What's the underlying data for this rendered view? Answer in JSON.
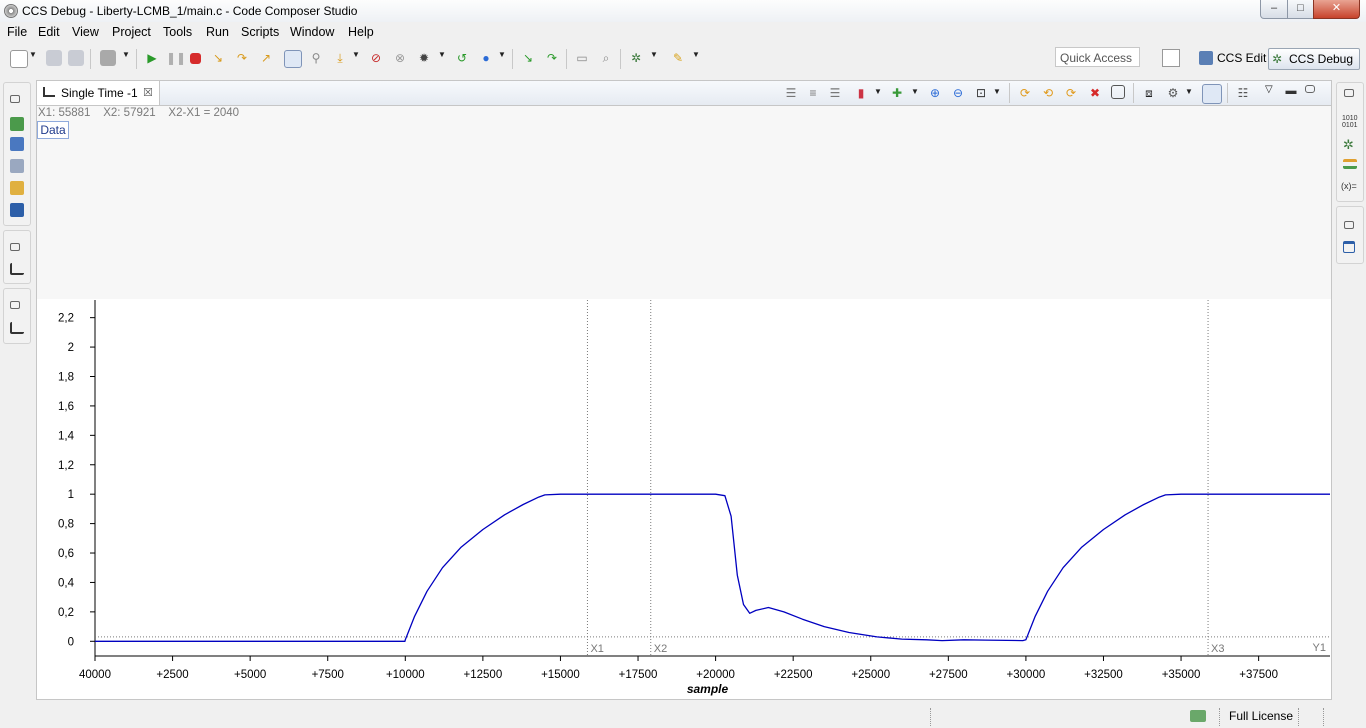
{
  "window": {
    "title": "CCS Debug - Liberty-LCMB_1/main.c - Code Composer Studio",
    "min_symbol": "–",
    "max_symbol": "□",
    "close_symbol": "✕"
  },
  "menu": [
    "File",
    "Edit",
    "View",
    "Project",
    "Tools",
    "Run",
    "Scripts",
    "Window",
    "Help"
  ],
  "toolbar": {
    "quick_access": "Quick Access",
    "perspective_edit": "CCS Edit",
    "perspective_debug": "CCS Debug"
  },
  "colors": {
    "accent": "#0000c0",
    "cursor_line": "#7a7a7a",
    "tab_bg": "#ffffff"
  },
  "view": {
    "tab_label": "Single Time -1",
    "close_symbol": "☒",
    "measure": "X1: 55881    X2: 57921    X2-X1 = 2040",
    "data_button": "Data"
  },
  "chart_data": {
    "type": "line",
    "xlabel": "sample",
    "ylabel": "",
    "x_ticks": [
      "40000",
      "+2500",
      "+5000",
      "+7500",
      "+10000",
      "+12500",
      "+15000",
      "+17500",
      "+20000",
      "+22500",
      "+25000",
      "+27500",
      "+30000",
      "+32500",
      "+35000",
      "+37500"
    ],
    "x_tick_values": [
      0,
      2500,
      5000,
      7500,
      10000,
      12500,
      15000,
      17500,
      20000,
      22500,
      25000,
      27500,
      30000,
      32500,
      35000,
      37500
    ],
    "y_ticks": [
      "0",
      "0,2",
      "0,4",
      "0,6",
      "0,8",
      "1",
      "1,2",
      "1,4",
      "1,6",
      "1,8",
      "2",
      "2,2"
    ],
    "y_tick_values": [
      0,
      0.2,
      0.4,
      0.6,
      0.8,
      1,
      1.2,
      1.4,
      1.6,
      1.8,
      2,
      2.2
    ],
    "xlim": [
      0,
      39800
    ],
    "ylim": [
      -0.1,
      2.32
    ],
    "cursors": [
      {
        "label": "X1",
        "x": 15870
      },
      {
        "label": "X2",
        "x": 17910
      },
      {
        "label": "X3",
        "x": 35870
      }
    ],
    "y_cursor": {
      "label": "Y1",
      "y": 0.03
    },
    "series": [
      {
        "x": [
          0,
          9990,
          10000,
          10300,
          10700,
          11200,
          11800,
          12500,
          13200,
          13800,
          14300,
          14500,
          15000,
          17500,
          20000,
          20300,
          20500,
          20700,
          20900,
          21100,
          21300,
          21700,
          22200,
          22800,
          23500,
          24300,
          25200,
          26000,
          26800,
          27300,
          28000,
          28700,
          29900,
          30000,
          30300,
          30700,
          31200,
          31800,
          32500,
          33200,
          33800,
          34300,
          34500,
          35000,
          37500,
          39800
        ],
        "y": [
          0,
          0,
          0.01,
          0.17,
          0.34,
          0.5,
          0.64,
          0.76,
          0.86,
          0.93,
          0.98,
          0.995,
          1,
          1,
          1,
          0.99,
          0.85,
          0.45,
          0.25,
          0.19,
          0.21,
          0.23,
          0.2,
          0.15,
          0.1,
          0.06,
          0.03,
          0.015,
          0.01,
          0.005,
          0.01,
          0.008,
          0.005,
          0.01,
          0.17,
          0.34,
          0.5,
          0.64,
          0.76,
          0.86,
          0.93,
          0.98,
          0.995,
          1,
          1,
          1
        ]
      }
    ]
  },
  "status": {
    "license": "Full License"
  }
}
